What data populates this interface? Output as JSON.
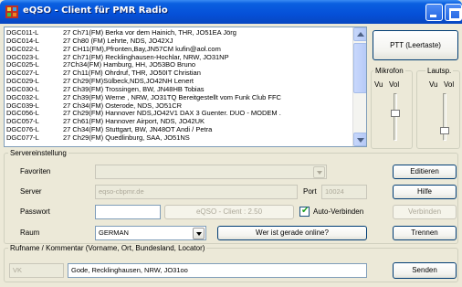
{
  "window": {
    "title": "eQSO - Client für PMR Radio",
    "icon": "eqso-app-icon"
  },
  "stations": [
    {
      "call": "DGC011-L",
      "info": "27 Ch71(FM) Berka vor dem Hainich, THR, JO51EA  Jörg"
    },
    {
      "call": "DGC014-L",
      "info": "27 Ch80 (FM) Lehrte, NDS, JO42XJ"
    },
    {
      "call": "DGC022-L",
      "info": "27 CH11(FM),Pfronten,Bay,JN57CM kufin@aol.com"
    },
    {
      "call": "DGC023-L",
      "info": "27 Ch71(FM) Recklinghausen-Hochlar, NRW, JO31NP"
    },
    {
      "call": "DGC025-L",
      "info": "27Ch34(FM) Hamburg, HH, JO53BO  Bruno"
    },
    {
      "call": "DGC027-L",
      "info": "27 Ch11(FM) Ohrdruf, THR, JO50IT  Christian"
    },
    {
      "call": "DGC029-L",
      "info": "27 Ch29(FM)Sülbeck,NDS,JO42NH   Lenert"
    },
    {
      "call": "DGC030-L",
      "info": "27 Ch39(FM) Trossingen, BW, JN48HB  Tobias"
    },
    {
      "call": "DGC032-L",
      "info": "27 Ch39(FM) Werne , NRW, JO31TQ    Bereitgestellt vom Funk Club FFC"
    },
    {
      "call": "DGC039-L",
      "info": "27 Ch34(FM) Osterode, NDS, JO51CR"
    },
    {
      "call": "DGC056-L",
      "info": "27 Ch29(FM) Hannover NDS,JO42V1 DAX 3 Guenter. DUO - MODEM ."
    },
    {
      "call": "DGC057-L",
      "info": "27 Ch61(FM) Hannover Airport, NDS, JO42UK"
    },
    {
      "call": "DGC076-L",
      "info": "27 Ch34(FM) Stuttgart, BW, JN48OT  Andi / Petra"
    },
    {
      "call": "DGC077-L",
      "info": "27 Ch29(FM) Quedlinburg, SAA, JO51NS"
    }
  ],
  "ptt": {
    "label": "PTT (Leertaste)"
  },
  "mic": {
    "title": "Mikrofon",
    "vu": "Vu",
    "vol": "Vol",
    "vol_level": 0.6
  },
  "speaker": {
    "title": "Lautsp.",
    "vu": "Vu",
    "vol": "Vol",
    "vol_level": 0.15
  },
  "server": {
    "title": "Servereinstellung",
    "favoriten_label": "Favoriten",
    "favoriten_value": "",
    "server_label": "Server",
    "server_value": "eqso-cbpmr.de",
    "port_label": "Port",
    "port_value": "10024",
    "passwort_label": "Passwort",
    "passwort_value": "",
    "version_label": "eQSO - Client : 2.50",
    "auto_label": "Auto-Verbinden",
    "auto_checked": true,
    "raum_label": "Raum",
    "raum_value": "GERMAN",
    "wer_label": "Wer ist gerade online?",
    "editieren_label": "Editieren",
    "hilfe_label": "Hilfe",
    "verbinden_label": "Verbinden",
    "trennen_label": "Trennen"
  },
  "comment": {
    "title": "Rufname / Kommentar (Vorname, Ort, Bundesland, Locator)",
    "callsign_value": "VK",
    "comment_value": "Gode, Recklinghausen, NRW, JO31oo",
    "senden_label": "Senden"
  },
  "colors": {
    "titlebar": "#0550d8",
    "window_bg": "#ece9d8",
    "field_border": "#7f9db9",
    "check_green": "#21a121"
  }
}
